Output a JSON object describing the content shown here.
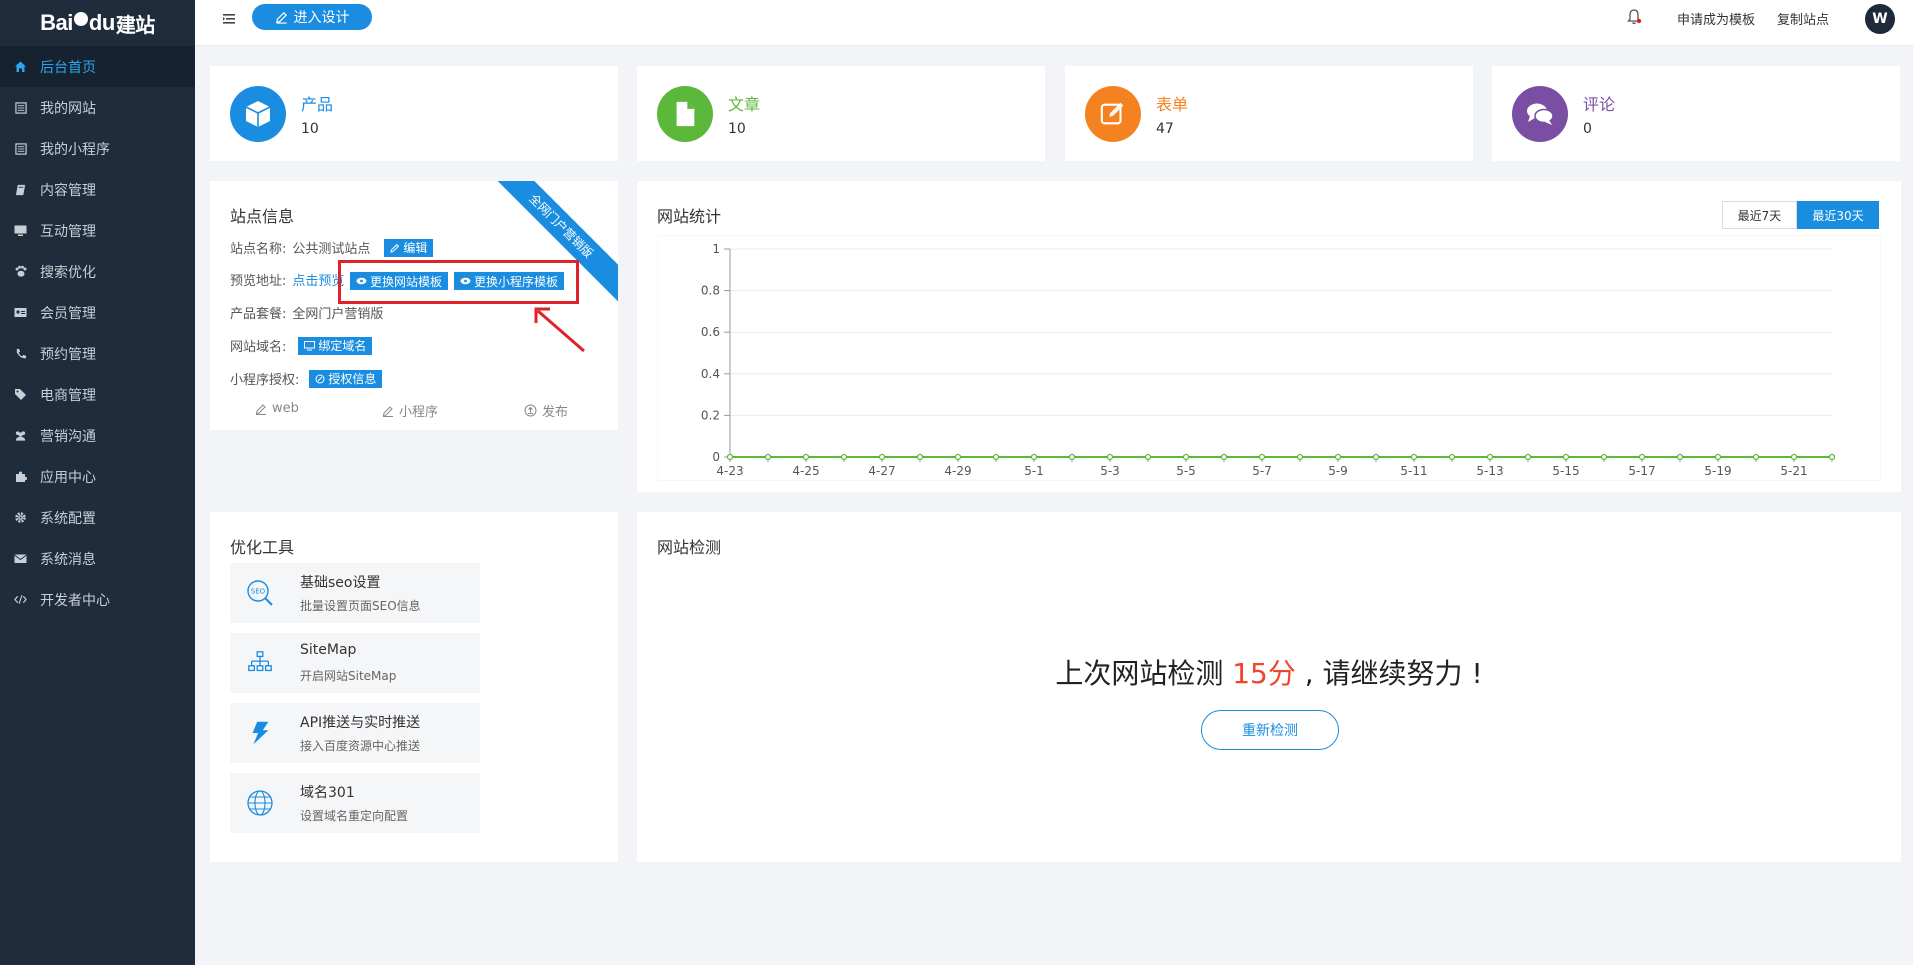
{
  "logo": {
    "text": "Bai",
    "text2": "du",
    "sub": "建站"
  },
  "sidebar": {
    "items": [
      {
        "label": "后台首页",
        "icon": "home-icon"
      },
      {
        "label": "我的网站",
        "icon": "list-icon"
      },
      {
        "label": "我的小程序",
        "icon": "list-icon"
      },
      {
        "label": "内容管理",
        "icon": "book-icon"
      },
      {
        "label": "互动管理",
        "icon": "monitor-icon"
      },
      {
        "label": "搜索优化",
        "icon": "paw-icon"
      },
      {
        "label": "会员管理",
        "icon": "id-card-icon"
      },
      {
        "label": "预约管理",
        "icon": "phone-icon"
      },
      {
        "label": "电商管理",
        "icon": "tags-icon"
      },
      {
        "label": "营销沟通",
        "icon": "users-icon"
      },
      {
        "label": "应用中心",
        "icon": "puzzle-icon"
      },
      {
        "label": "系统配置",
        "icon": "gear-icon"
      },
      {
        "label": "系统消息",
        "icon": "envelope-icon"
      },
      {
        "label": "开发者中心",
        "icon": "code-icon"
      }
    ]
  },
  "topbar": {
    "design_label": "进入设计",
    "apply_template": "申请成为模板",
    "copy_site": "复制站点",
    "avatar": "W"
  },
  "stats": [
    {
      "label": "产品",
      "value": "10",
      "color": "#1a8de0",
      "icon": "cube-icon"
    },
    {
      "label": "文章",
      "value": "10",
      "color": "#5cb83a",
      "icon": "document-icon"
    },
    {
      "label": "表单",
      "value": "47",
      "color": "#f58220",
      "icon": "form-edit-icon"
    },
    {
      "label": "评论",
      "value": "0",
      "color": "#7a4ea3",
      "icon": "comments-icon"
    }
  ],
  "site_info": {
    "title": "站点信息",
    "ribbon": "全网门户营销版",
    "name_key": "站点名称:",
    "name_val": "公共测试站点",
    "edit_tag": "编辑",
    "preview_key": "预览地址:",
    "preview_link": "点击预览",
    "change_web_tpl": "更换网站模板",
    "change_mini_tpl": "更换小程序模板",
    "package_key": "产品套餐:",
    "package_val": "全网门户营销版",
    "domain_key": "网站域名:",
    "bind_domain": "绑定域名",
    "mini_auth_key": "小程序授权:",
    "auth_info": "授权信息",
    "link_web": "web",
    "link_mini": "小程序",
    "link_publish": "发布"
  },
  "stats_panel": {
    "title": "网站统计",
    "range_7": "最近7天",
    "range_30": "最近30天"
  },
  "chart_data": {
    "type": "line",
    "title": "",
    "x": [
      "4-23",
      "4-24",
      "4-25",
      "4-26",
      "4-27",
      "4-28",
      "4-29",
      "4-30",
      "5-1",
      "5-2",
      "5-3",
      "5-4",
      "5-5",
      "5-6",
      "5-7",
      "5-8",
      "5-9",
      "5-10",
      "5-11",
      "5-12",
      "5-13",
      "5-14",
      "5-15",
      "5-16",
      "5-17",
      "5-18",
      "5-19",
      "5-20",
      "5-21",
      "5-22"
    ],
    "x_tick_labels": [
      "4-23",
      "4-25",
      "4-27",
      "4-29",
      "5-1",
      "5-3",
      "5-5",
      "5-7",
      "5-9",
      "5-11",
      "5-13",
      "5-15",
      "5-17",
      "5-19",
      "5-21"
    ],
    "series": [
      {
        "values": [
          0,
          0,
          0,
          0,
          0,
          0,
          0,
          0,
          0,
          0,
          0,
          0,
          0,
          0,
          0,
          0,
          0,
          0,
          0,
          0,
          0,
          0,
          0,
          0,
          0,
          0,
          0,
          0,
          0,
          0
        ],
        "color": "#5cb83a"
      }
    ],
    "y_ticks": [
      "0",
      "0.2",
      "0.4",
      "0.6",
      "0.8",
      "1"
    ],
    "ylim": [
      0,
      1
    ],
    "grid": true
  },
  "tools": {
    "title": "优化工具",
    "items": [
      {
        "title": "基础seo设置",
        "desc": "批量设置页面SEO信息",
        "icon": "seo-icon"
      },
      {
        "title": "SiteMap",
        "desc": "开启网站SiteMap",
        "icon": "sitemap-icon"
      },
      {
        "title": "API推送与实时推送",
        "desc": "接入百度资源中心推送",
        "icon": "lightning-icon"
      },
      {
        "title": "域名301",
        "desc": "设置域名重定向配置",
        "icon": "globe-icon"
      }
    ]
  },
  "detect": {
    "title": "网站检测",
    "pre": "上次网站检测 ",
    "score": "15分",
    "post": " , 请继续努力 !",
    "button": "重新检测"
  }
}
